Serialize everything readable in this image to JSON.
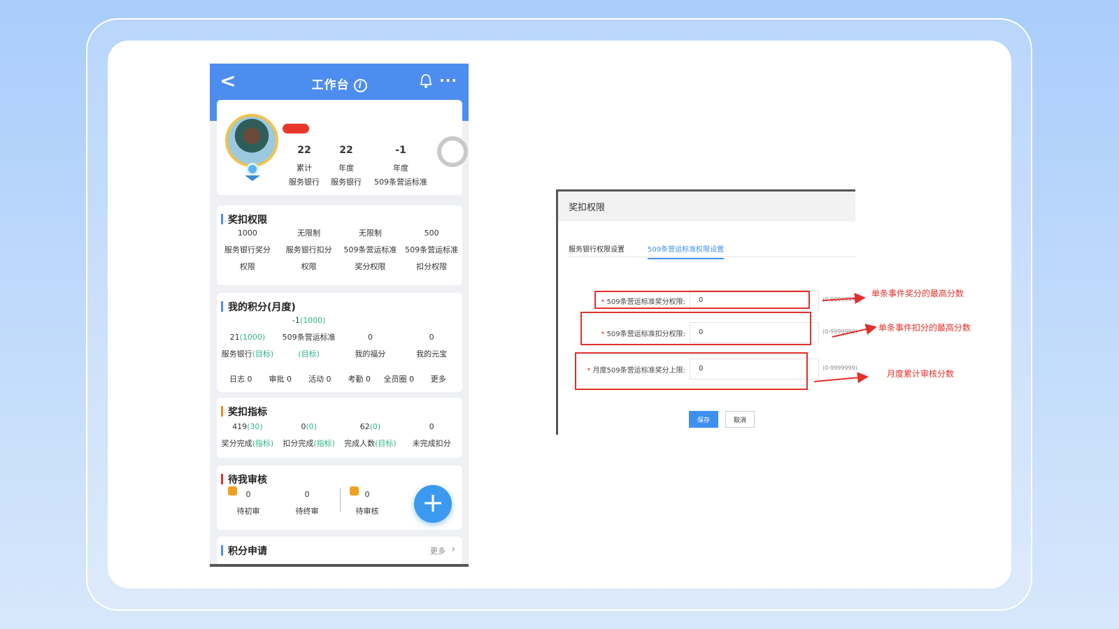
{
  "phone": {
    "header": {
      "back_icon": "<",
      "title": "工作台",
      "info_icon": "i",
      "more_icon": "···"
    },
    "profile": {
      "stats": [
        {
          "value": "22",
          "label1": "累计",
          "label2": "服务银行"
        },
        {
          "value": "22",
          "label1": "年度",
          "label2": "服务银行"
        },
        {
          "value": "-1",
          "label1": "年度",
          "label2": "509条营运标准"
        }
      ]
    },
    "perm": {
      "title": "奖扣权限",
      "values": [
        "1000",
        "无限制",
        "无限制",
        "500"
      ],
      "labels1": [
        "服务银行奖分",
        "服务银行扣分",
        "509条营运标准",
        "509条营运标准"
      ],
      "labels2": [
        "权限",
        "权限",
        "奖分权限",
        "扣分权限"
      ]
    },
    "score": {
      "title": "我的积分(月度)",
      "c1_value": "21",
      "c1_target": "(1000)",
      "c1_label": "服务银行",
      "c1_tag": "(目标)",
      "c2_value": "-1",
      "c2_target": "(1000)",
      "c2_label": "509条营运标准",
      "c2_tag": "(目标)",
      "c3_value": "0",
      "c3_label": "我的福分",
      "c4_value": "0",
      "c4_label": "我的元宝",
      "links": [
        "日志 0",
        "审批 0",
        "活动 0",
        "考勤 0",
        "全员圈 0"
      ],
      "more": "更多"
    },
    "index": {
      "title": "奖扣指标",
      "values": [
        "419",
        "0",
        "62",
        "0"
      ],
      "targets": [
        "(30)",
        "(0)",
        "(0)",
        ""
      ],
      "labels": [
        "奖分完成",
        "扣分完成",
        "完成人数",
        "未完成扣分"
      ],
      "tags": [
        "(指标)",
        "(指标)",
        "(目标)",
        ""
      ]
    },
    "review": {
      "title": "待我审核",
      "values": [
        "0",
        "0",
        "0"
      ],
      "labels": [
        "待初审",
        "待终审",
        "待审核"
      ],
      "plus": "+"
    },
    "apply": {
      "title": "积分申请",
      "more": "更多"
    }
  },
  "panel": {
    "title": "奖扣权限",
    "tabs": [
      "服务银行权限设置",
      "509条营运标准权限设置"
    ],
    "fields": [
      {
        "label": "509条营运标准奖分权限:",
        "value": "0",
        "hint": "(0-9999999)"
      },
      {
        "label": "509条营运标准扣分权限:",
        "value": "0",
        "hint": "(0-9999999)"
      },
      {
        "label": "月度509条营运标准奖分上限:",
        "value": "0",
        "hint": "(0-9999999)"
      }
    ],
    "save": "保存",
    "cancel": "取消"
  },
  "annotations": [
    "单条事件奖分的最高分数",
    "单条事件扣分的最高分数",
    "月度累计审核分数"
  ],
  "colors": {
    "accent": "#4e8df0",
    "highlight": "#e0302a",
    "positive": "#2fb388"
  }
}
